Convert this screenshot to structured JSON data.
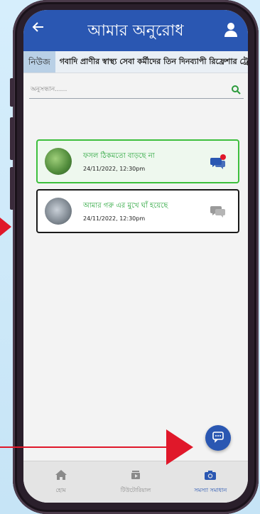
{
  "appbar": {
    "title": "আমার অনুরোধ",
    "back_icon": "arrow-left-icon",
    "user_icon": "user-icon"
  },
  "ticker": {
    "tag": "নিউজ",
    "text": "গবাদি প্রাণীর স্বাস্থ্য সেবা কর্মীদের তিন দিনব্যাপী রিফ্রেশার ট্রে"
  },
  "search": {
    "placeholder": "অনুসন্ধান......"
  },
  "requests": [
    {
      "title": "ফসল ঠিকমতো বাড়ছে না",
      "date": "24/11/2022, 12:30pm",
      "unread": true
    },
    {
      "title": "আমার গরু এর মুখে ঘাঁ হয়েছে",
      "date": "24/11/2022, 12:30pm",
      "unread": false
    }
  ],
  "nav": [
    {
      "label": "হোম",
      "icon": "home-icon",
      "active": false
    },
    {
      "label": "টিউটোরিয়াল",
      "icon": "tutorial-icon",
      "active": false
    },
    {
      "label": "সমস্যা সমাধান",
      "icon": "camera-icon",
      "active": true
    }
  ],
  "colors": {
    "primary": "#2a57b2",
    "accent_green": "#3dbf3d",
    "arrow_red": "#e0182a"
  }
}
